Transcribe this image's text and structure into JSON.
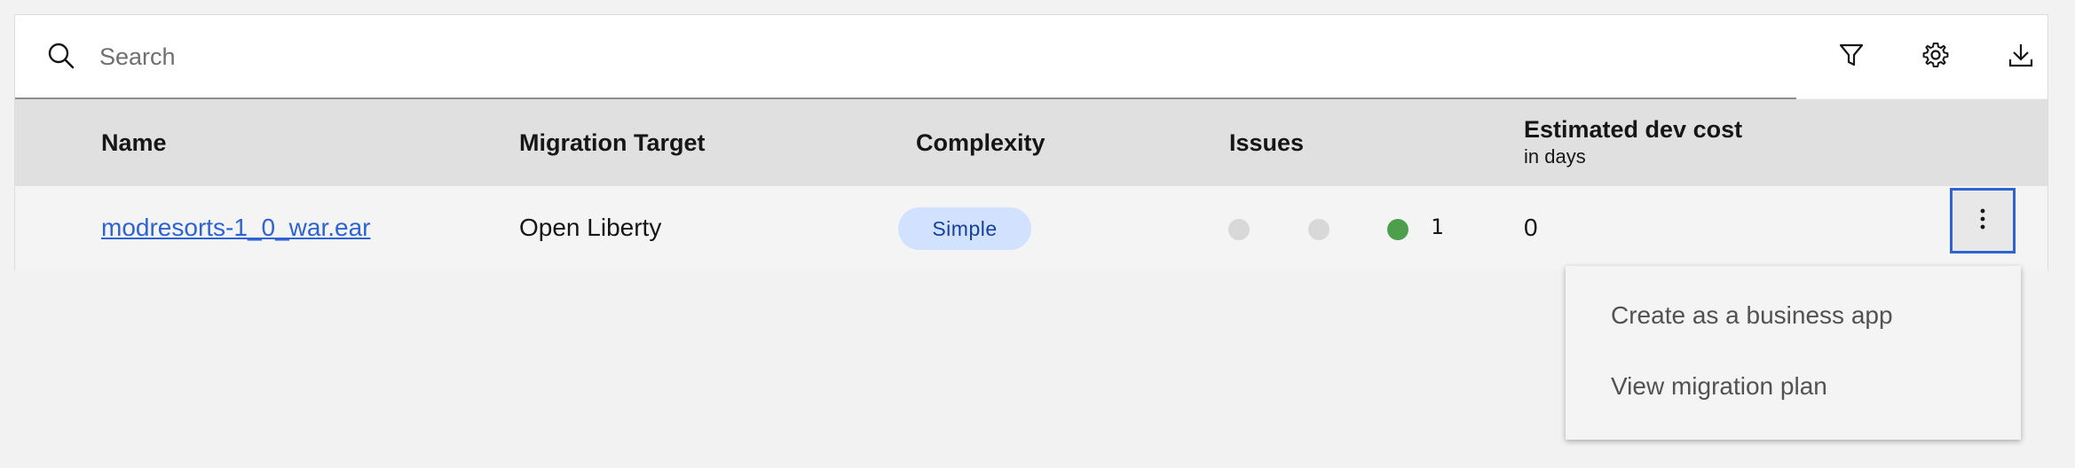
{
  "search": {
    "placeholder": "Search",
    "value": ""
  },
  "toolbar": {
    "filter_icon": "filter-icon",
    "settings_icon": "gear-icon",
    "download_icon": "download-icon"
  },
  "table": {
    "headers": {
      "name": "Name",
      "migration_target": "Migration Target",
      "complexity": "Complexity",
      "issues": "Issues",
      "dev_cost": "Estimated dev cost",
      "dev_cost_unit": "in days"
    },
    "rows": [
      {
        "name": "modresorts-1_0_war.ear",
        "migration_target": "Open Liberty",
        "complexity": "Simple",
        "issues": {
          "critical_color": "#d8d8d8",
          "warning_color": "#d8d8d8",
          "info_color": "#4d9e4d",
          "count": "1"
        },
        "dev_cost": "0"
      }
    ]
  },
  "overflow_menu": {
    "icon": "overflow-menu-vertical-icon",
    "items": [
      {
        "label": "Create as a business app"
      },
      {
        "label": "View migration plan"
      }
    ]
  },
  "colors": {
    "accent": "#2d63d4",
    "tag_bg": "#d0e2ff",
    "header_bg": "#e0e0e0"
  }
}
